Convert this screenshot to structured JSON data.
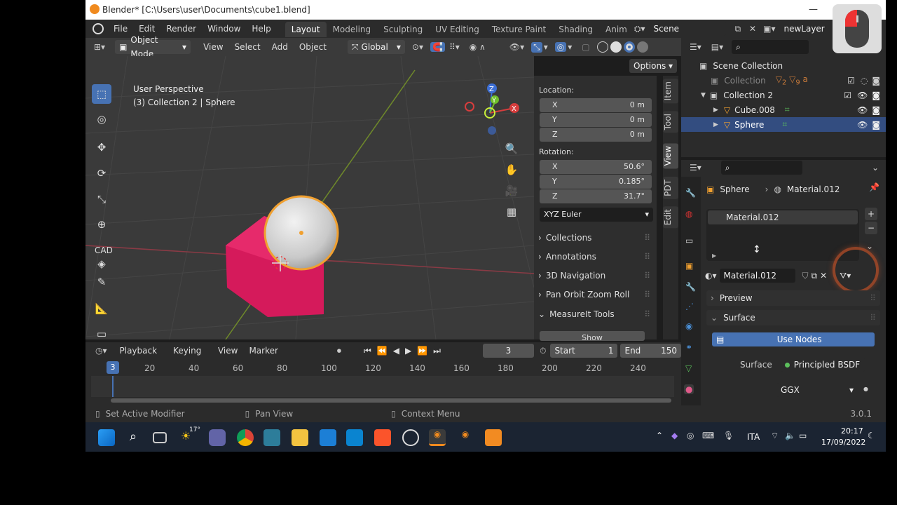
{
  "window": {
    "title": "Blender* [C:\\Users\\user\\Documents\\cube1.blend]"
  },
  "menu": {
    "items": [
      "File",
      "Edit",
      "Render",
      "Window",
      "Help"
    ]
  },
  "workspaces": [
    "Layout",
    "Modeling",
    "Sculpting",
    "UV Editing",
    "Texture Paint",
    "Shading",
    "Anim"
  ],
  "scene": {
    "name": "Scene",
    "layer": "newLayer"
  },
  "viewport_header": {
    "mode": "Object Mode",
    "menus": [
      "View",
      "Select",
      "Add",
      "Object"
    ],
    "orientation": "Global",
    "options": "Options"
  },
  "viewport": {
    "perspective": "User Perspective",
    "context": "(3) Collection 2 | Sphere",
    "cad_label": "CAD"
  },
  "npanel": {
    "location_label": "Location:",
    "location": [
      {
        "axis": "X",
        "value": "0 m"
      },
      {
        "axis": "Y",
        "value": "0 m"
      },
      {
        "axis": "Z",
        "value": "0 m"
      }
    ],
    "rotation_label": "Rotation:",
    "rotation": [
      {
        "axis": "X",
        "value": "50.6°"
      },
      {
        "axis": "Y",
        "value": "0.185°"
      },
      {
        "axis": "Z",
        "value": "31.7°"
      }
    ],
    "rotation_mode": "XYZ Euler",
    "sections": [
      "Collections",
      "Annotations",
      "3D Navigation",
      "Pan Orbit Zoom Roll",
      "MeasureIt Tools"
    ],
    "partial_button": "Show"
  },
  "sidetabs": [
    "Item",
    "Tool",
    "View",
    "PDT",
    "Edit"
  ],
  "timeline": {
    "menus": [
      "Playback",
      "Keying",
      "View",
      "Marker"
    ],
    "current_frame": "3",
    "start_label": "Start",
    "start": "1",
    "end_label": "End",
    "end": "150",
    "ruler": [
      "20",
      "40",
      "60",
      "80",
      "100",
      "120",
      "140",
      "160",
      "180",
      "200",
      "220",
      "240"
    ],
    "playhead": "3"
  },
  "outliner": {
    "root": "Scene Collection",
    "items": [
      {
        "name": "Collection",
        "level": 1
      },
      {
        "name": "Collection 2",
        "level": 1
      },
      {
        "name": "Cube.008",
        "level": 2
      },
      {
        "name": "Sphere",
        "level": 2
      }
    ],
    "badge_counts": [
      "2",
      "9"
    ]
  },
  "properties": {
    "breadcrumb_object": "Sphere",
    "breadcrumb_material": "Material.012",
    "slot": "Material.012",
    "material_name": "Material.012",
    "sections": {
      "preview": "Preview",
      "surface": "Surface"
    },
    "use_nodes": "Use Nodes",
    "surface_label": "Surface",
    "surface_value": "Principled BSDF",
    "distribution": "GGX"
  },
  "statusbar": {
    "left": "Set Active Modifier",
    "middle": "Pan View",
    "right": "Context Menu",
    "version": "3.0.1"
  },
  "taskbar": {
    "weather": "17°",
    "lang": "ITA",
    "time": "20:17",
    "date": "17/09/2022"
  },
  "colors": {
    "accent": "#4772b3",
    "selected_row": "#334d80",
    "cube": "#d51a5b",
    "highlight_ring": "#f0a030"
  }
}
